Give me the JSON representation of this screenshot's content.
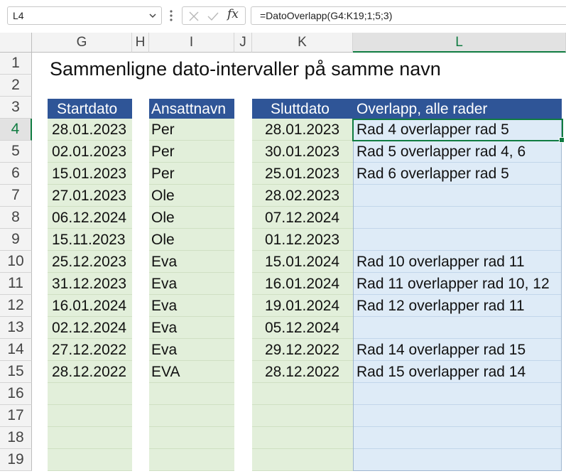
{
  "formula_bar": {
    "name_box": "L4",
    "formula": "=DatoOverlapp(G4:K19;1;5;3)",
    "fx_label": "fx"
  },
  "columns": [
    "G",
    "H",
    "I",
    "J",
    "K",
    "L"
  ],
  "rows": [
    "1",
    "2",
    "3",
    "4",
    "5",
    "6",
    "7",
    "8",
    "9",
    "10",
    "11",
    "12",
    "13",
    "14",
    "15",
    "16",
    "17",
    "18",
    "19"
  ],
  "sheet": {
    "title": "Sammenligne dato-intervaller på samme navn",
    "headers": {
      "startdato": "Startdato",
      "ansattnavn": "Ansattnavn",
      "sluttdato": "Sluttdato",
      "overlapp": "Overlapp, alle rader"
    },
    "data": [
      {
        "start": "28.01.2023",
        "name": "Per",
        "end": "28.01.2023",
        "overlap": "Rad 4 overlapper rad 5"
      },
      {
        "start": "02.01.2023",
        "name": "Per",
        "end": "30.01.2023",
        "overlap": "Rad 5 overlapper rad 4, 6"
      },
      {
        "start": "15.01.2023",
        "name": "Per",
        "end": "25.01.2023",
        "overlap": "Rad 6 overlapper rad 5"
      },
      {
        "start": "27.01.2023",
        "name": "Ole",
        "end": "28.02.2023",
        "overlap": ""
      },
      {
        "start": "06.12.2024",
        "name": "Ole",
        "end": "07.12.2024",
        "overlap": ""
      },
      {
        "start": "15.11.2023",
        "name": "Ole",
        "end": "01.12.2023",
        "overlap": ""
      },
      {
        "start": "25.12.2023",
        "name": "Eva",
        "end": "15.01.2024",
        "overlap": "Rad 10 overlapper rad 11"
      },
      {
        "start": "31.12.2023",
        "name": "Eva",
        "end": "16.01.2024",
        "overlap": "Rad 11 overlapper rad 10, 12"
      },
      {
        "start": "16.01.2024",
        "name": "Eva",
        "end": "19.01.2024",
        "overlap": "Rad 12 overlapper rad 11"
      },
      {
        "start": "02.12.2024",
        "name": "Eva",
        "end": "05.12.2024",
        "overlap": ""
      },
      {
        "start": "27.12.2022",
        "name": "Eva",
        "end": "29.12.2022",
        "overlap": "Rad 14 overlapper rad 15"
      },
      {
        "start": "28.12.2022",
        "name": "EVA",
        "end": "28.12.2022",
        "overlap": "Rad 15 overlapper rad 14"
      },
      {
        "start": "",
        "name": "",
        "end": "",
        "overlap": ""
      },
      {
        "start": "",
        "name": "",
        "end": "",
        "overlap": ""
      },
      {
        "start": "",
        "name": "",
        "end": "",
        "overlap": ""
      },
      {
        "start": "",
        "name": "",
        "end": "",
        "overlap": ""
      }
    ]
  },
  "selected_cell": {
    "column": "L",
    "row": "4"
  },
  "colors": {
    "header_fill": "#2f5597",
    "green_fill": "#e2efda",
    "blue_fill": "#deebf7",
    "selection": "#107c41"
  }
}
